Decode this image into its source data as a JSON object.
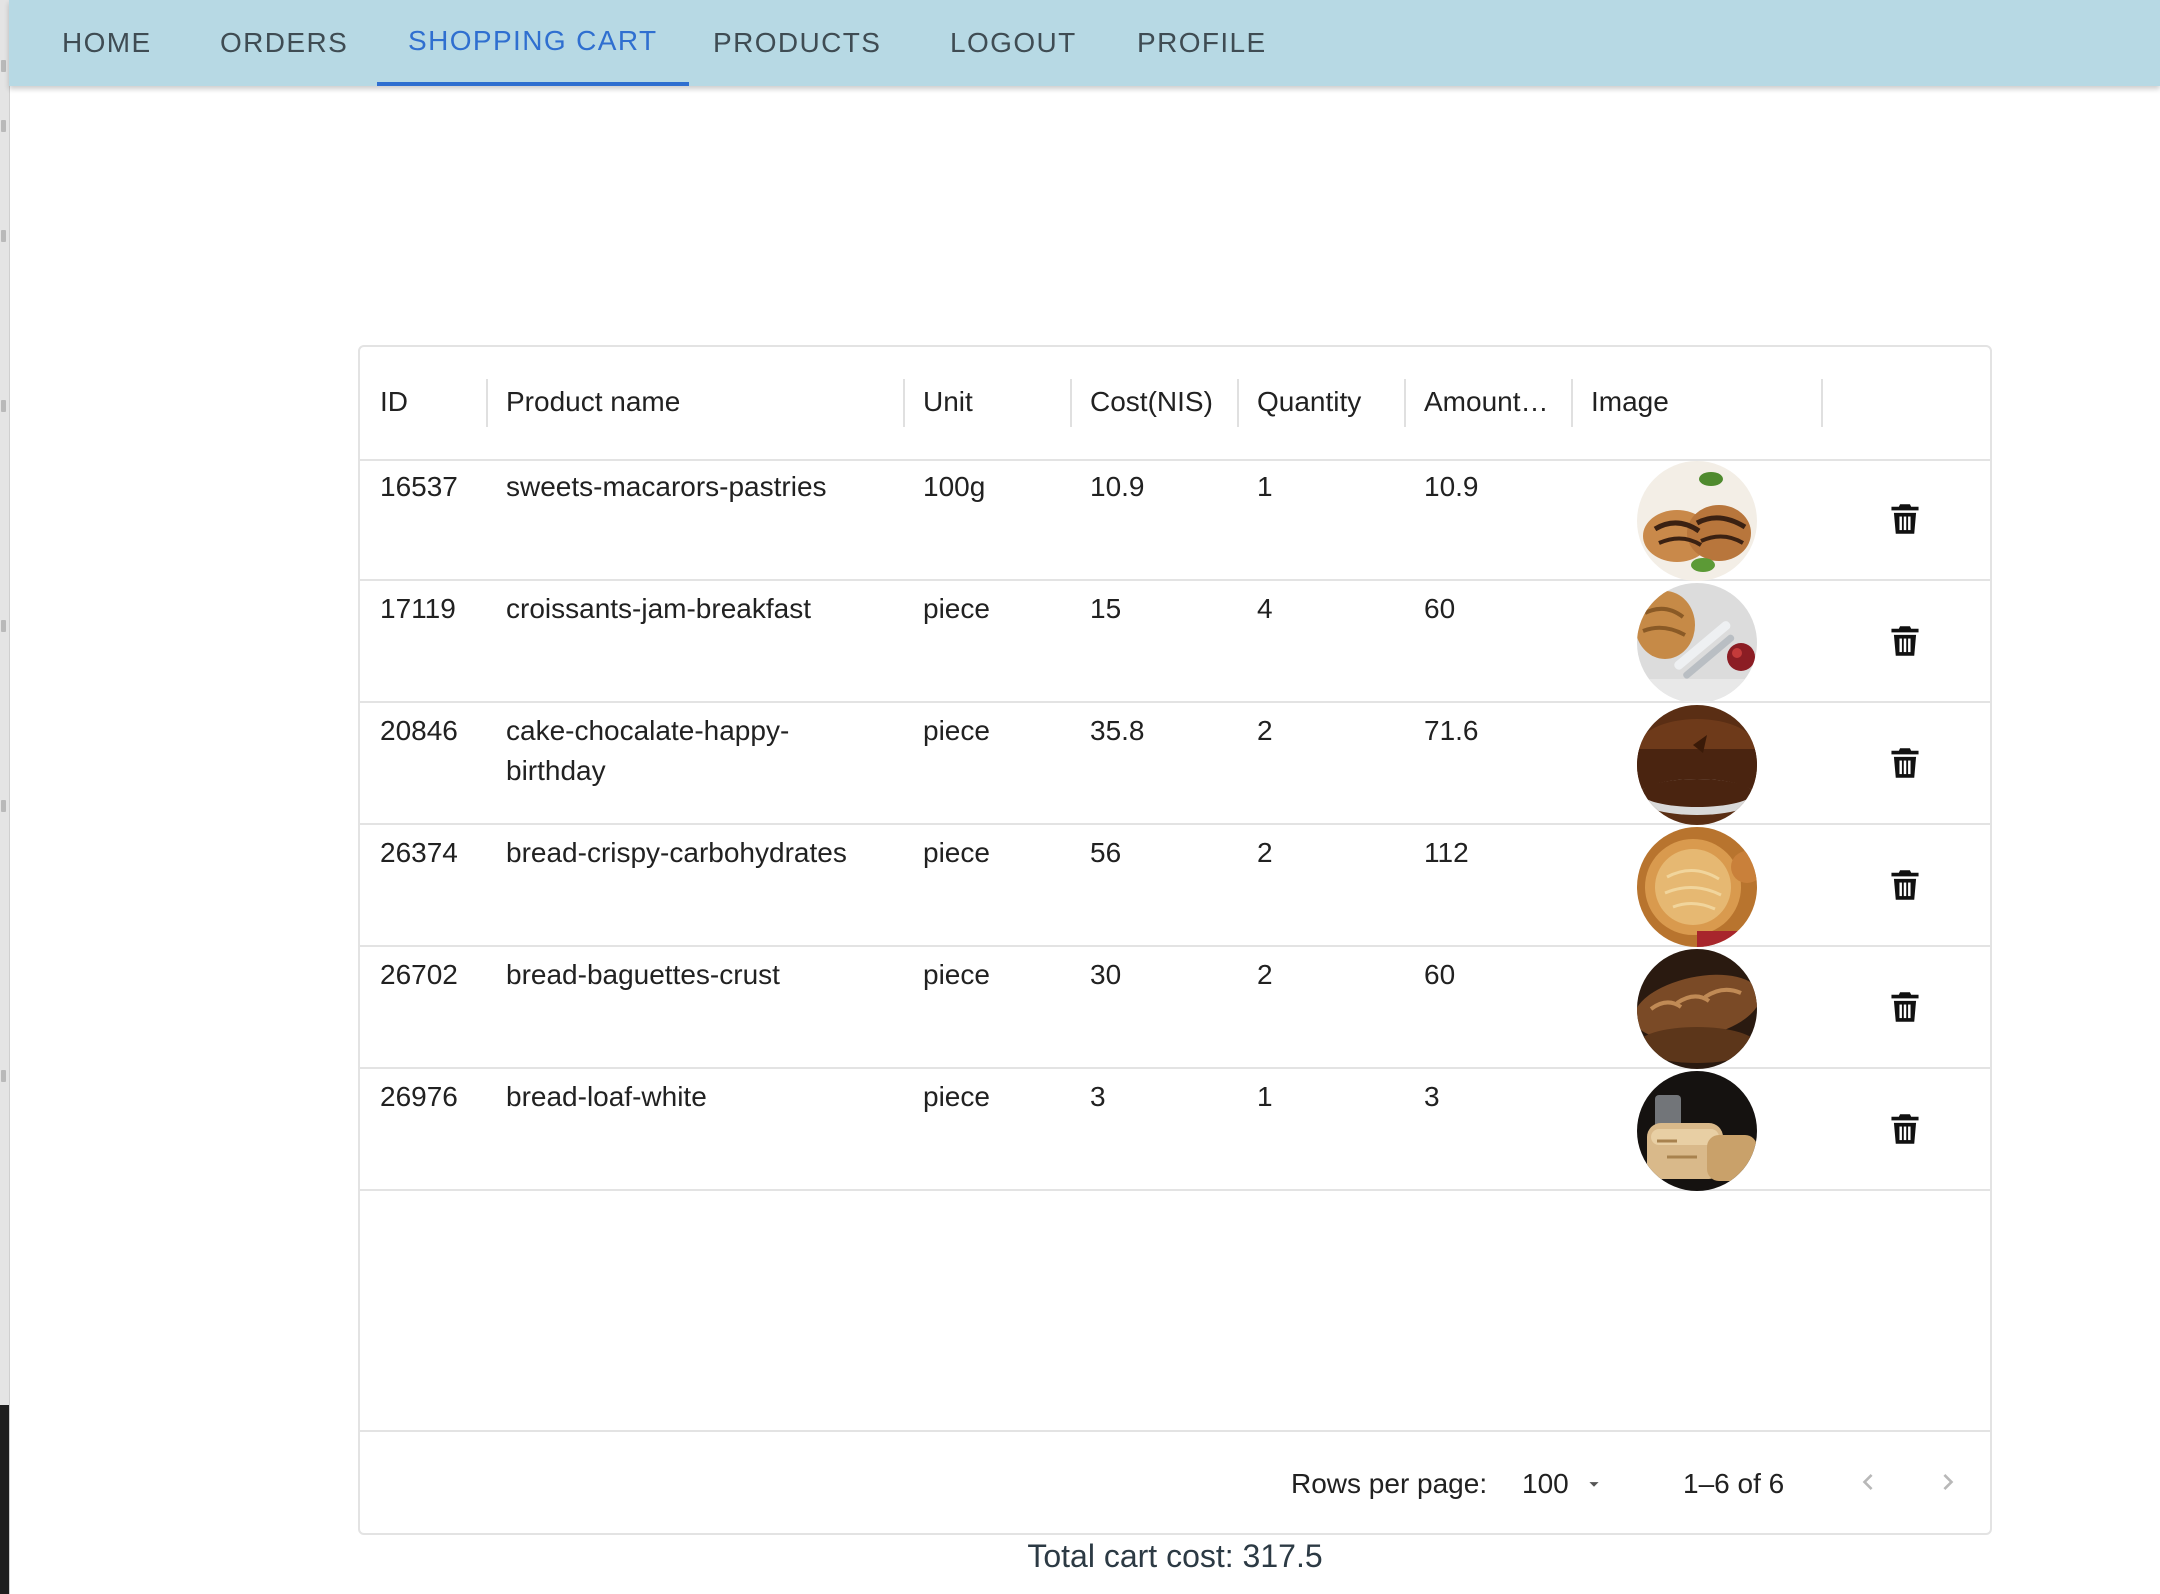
{
  "nav": {
    "tabs": [
      {
        "label": "HOME"
      },
      {
        "label": "ORDERS"
      },
      {
        "label": "SHOPPING CART",
        "active": true
      },
      {
        "label": "PRODUCTS"
      },
      {
        "label": "LOGOUT"
      },
      {
        "label": "PROFILE"
      }
    ]
  },
  "table": {
    "columns": [
      "ID",
      "Product name",
      "Unit",
      "Cost(NIS)",
      "Quantity",
      "Amount…",
      "Image"
    ],
    "rows": [
      {
        "id": "16537",
        "name": "sweets-macarors-pastries",
        "unit": "100g",
        "cost": "10.9",
        "quantity": "1",
        "amount": "10.9",
        "image": "pastries-thumbnail"
      },
      {
        "id": "17119",
        "name": "croissants-jam-breakfast",
        "unit": "piece",
        "cost": "15",
        "quantity": "4",
        "amount": "60",
        "image": "croissants-thumbnail"
      },
      {
        "id": "20846",
        "name": "cake-chocalate-happy-birthday",
        "unit": "piece",
        "cost": "35.8",
        "quantity": "2",
        "amount": "71.6",
        "image": "chocolate-cake-thumbnail"
      },
      {
        "id": "26374",
        "name": "bread-crispy-carbohydrates",
        "unit": "piece",
        "cost": "56",
        "quantity": "2",
        "amount": "112",
        "image": "round-bread-thumbnail"
      },
      {
        "id": "26702",
        "name": "bread-baguettes-crust",
        "unit": "piece",
        "cost": "30",
        "quantity": "2",
        "amount": "60",
        "image": "baguette-thumbnail"
      },
      {
        "id": "26976",
        "name": "bread-loaf-white",
        "unit": "piece",
        "cost": "3",
        "quantity": "1",
        "amount": "3",
        "image": "white-loaf-thumbnail"
      }
    ]
  },
  "pagination": {
    "rows_per_page_label": "Rows per page:",
    "rows_per_page_value": "100",
    "range": "1–6 of 6"
  },
  "summary": {
    "total_label": "Total cart cost: 317.5"
  },
  "colors": {
    "navbar": "#b7d9e4",
    "accent": "#2f6fd0"
  }
}
